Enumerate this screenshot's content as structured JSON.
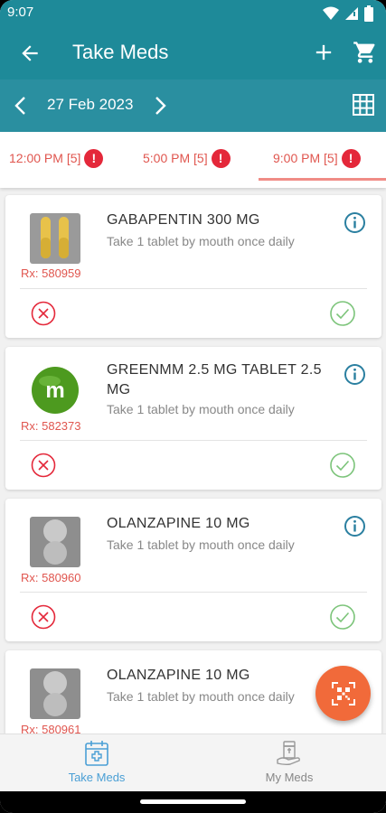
{
  "status_bar": {
    "time": "9:07"
  },
  "app_bar": {
    "title": "Take Meds"
  },
  "date_bar": {
    "date": "27 Feb 2023"
  },
  "tabs": [
    {
      "label": "12:00 PM [5]",
      "alert": "!"
    },
    {
      "label": "5:00 PM [5]",
      "alert": "!"
    },
    {
      "label": "9:00 PM [5]",
      "alert": "!"
    }
  ],
  "meds": [
    {
      "name": "GABAPENTIN 300 MG",
      "instructions": "Take 1 tablet by mouth once daily",
      "rx": "Rx: 580959",
      "pill_type": "yellow-capsules"
    },
    {
      "name": "GREENMM 2.5 MG TABLET 2.5 MG",
      "instructions": "Take 1 tablet by mouth once daily",
      "rx": "Rx: 582373",
      "pill_type": "green-m-candy",
      "pill_letter": "m"
    },
    {
      "name": "OLANZAPINE 10 MG",
      "instructions": "Take 1 tablet by mouth once daily",
      "rx": "Rx: 580960",
      "pill_type": "gray-tablets"
    },
    {
      "name": "OLANZAPINE 10 MG",
      "instructions": "Take 1 tablet by mouth once daily",
      "rx": "Rx: 580961",
      "pill_type": "gray-tablets"
    }
  ],
  "bottom_nav": [
    {
      "label": "Take Meds",
      "active": true
    },
    {
      "label": "My Meds",
      "active": false
    }
  ],
  "colors": {
    "primary": "#1e8a99",
    "accent": "#e0564f",
    "alert": "#e4283a",
    "success": "#7cc47a",
    "fab": "#f16a3a",
    "info": "#2a7fa0",
    "nav_active": "#4a9fd5"
  }
}
